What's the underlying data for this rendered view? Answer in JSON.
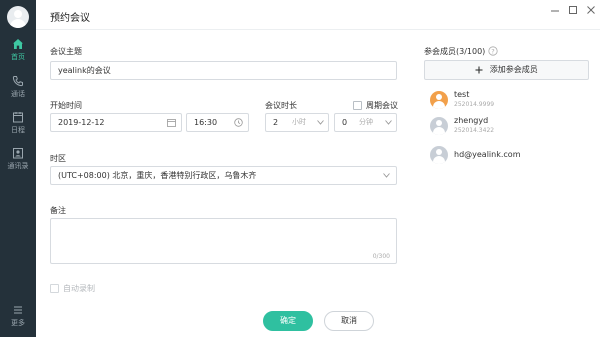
{
  "sidebar": {
    "items": [
      {
        "label": "首页",
        "icon": "home-icon"
      },
      {
        "label": "通话",
        "icon": "phone-icon"
      },
      {
        "label": "日程",
        "icon": "calendar-icon"
      },
      {
        "label": "通讯录",
        "icon": "contacts-icon"
      },
      {
        "label": "更多",
        "icon": "menu-icon"
      }
    ]
  },
  "window": {
    "title": "预约会议",
    "controls": [
      "minimize-icon",
      "maximize-icon",
      "close-icon"
    ]
  },
  "form": {
    "subject_label": "会议主题",
    "subject_value": "yealink的会议",
    "start_label": "开始时间",
    "date_value": "2019-12-12",
    "time_value": "16:30",
    "duration_label": "会议时长",
    "hours_value": "2",
    "hours_unit": "小时",
    "minutes_value": "0",
    "minutes_unit": "分钟",
    "recurring_label": "周期会议",
    "timezone_label": "时区",
    "timezone_value": "(UTC+08:00) 北京，重庆，香港特别行政区，乌鲁木齐",
    "remark_label": "备注",
    "remark_counter": "0/300",
    "auto_record_label": "自动录制"
  },
  "buttons": {
    "confirm": "确定",
    "cancel": "取消"
  },
  "participants": {
    "header": "参会成员(3/100)",
    "add_label": "添加参会成员",
    "members": [
      {
        "name": "test",
        "sub": "252014.9999"
      },
      {
        "name": "zhengyd",
        "sub": "252014.3422"
      },
      {
        "name": "hd@yealink.com",
        "sub": ""
      }
    ]
  },
  "colors": {
    "accent": "#2fc0a0",
    "sidebar": "#24313a",
    "avatar_orange": "#f2a04a",
    "avatar_gray": "#c8ced6"
  }
}
